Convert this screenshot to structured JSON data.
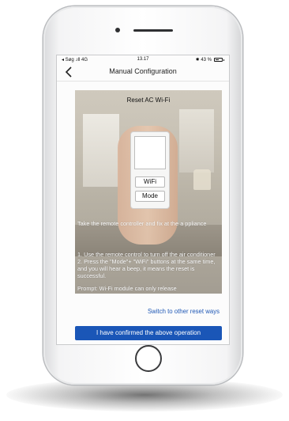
{
  "status_bar": {
    "carrier": "◂ Søg  .ıll 4G",
    "time": "13.17",
    "battery": "✸ 43 %"
  },
  "nav": {
    "title": "Manual Configuration"
  },
  "tutorial": {
    "title": "Reset AC Wi-Fi",
    "keys": {
      "wifi": "WiFi",
      "mode": "Mode"
    },
    "instructions": [
      "Take the remote controller and fix at the a ppliance",
      "1. Use the remote control to turn off the air conditioner\n2. Press the \"Mode\"+ \"WiFi\" buttons at the same time, and you will hear a beep, it means the reset is successful.",
      "Prompt: Wi-Fi module can only release"
    ]
  },
  "switch_link": "Switch to other reset ways",
  "confirm_button": "I have confirmed the above operation",
  "colors": {
    "accent": "#1a56b7",
    "link": "#1f58b5"
  }
}
